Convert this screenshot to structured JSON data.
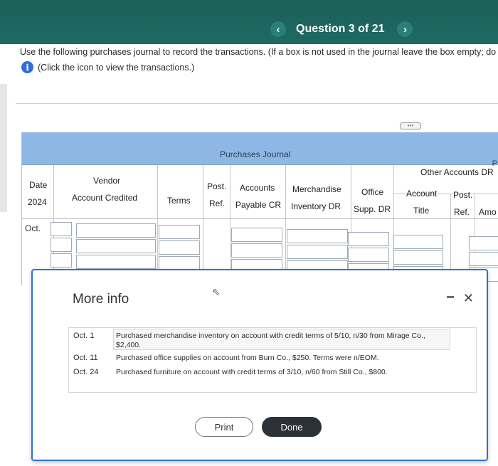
{
  "header": {
    "title": "Question 3 of 21",
    "prev_glyph": "‹",
    "next_glyph": "›",
    "band_color": "#1f6a63"
  },
  "instructions": {
    "line1": "Use the following purchases journal to record the transactions. (If a box is not used in the journal leave the box empty; do not s",
    "line2": "(Click the icon to view the transactions.)",
    "info_glyph": "i"
  },
  "journal": {
    "title": "Purchases Journal",
    "cut_label": "P",
    "headers": {
      "date": "Date",
      "year": "2024",
      "vendor_line1": "Vendor",
      "vendor_line2": "Account Credited",
      "terms": "Terms",
      "post_line1": "Post.",
      "post_line2": "Ref.",
      "ap_line1": "Accounts",
      "ap_line2": "Payable CR",
      "merch_line1": "Merchandise",
      "merch_line2": "Inventory DR",
      "office_line1": "Office",
      "office_line2": "Supp. DR",
      "other_group": "Other Accounts DR",
      "acct_line1": "Account",
      "acct_line2": "Title",
      "post2_line1": "Post.",
      "post2_line2": "Ref.",
      "amount_cut": "Amo"
    },
    "month_label": "Oct.",
    "header_color": "#8fb7e6"
  },
  "modal": {
    "title": "More info",
    "print_label": "Print",
    "done_label": "Done",
    "close_glyph": "✕",
    "transactions": [
      {
        "date": "Oct. 1",
        "line1": "Purchased merchandise inventory on account with credit terms of 5/10, n/30 from Mirage Co.,",
        "line2": "$2,400."
      },
      {
        "date": "Oct. 11",
        "line1": "Purchased office supplies on account from Burn Co., $250. Terms were n/EOM."
      },
      {
        "date": "Oct. 24",
        "line1": "Purchased furniture on account with credit terms of 3/10, n/60 from Still Co., $800."
      }
    ],
    "border_color": "#2e72d2"
  }
}
